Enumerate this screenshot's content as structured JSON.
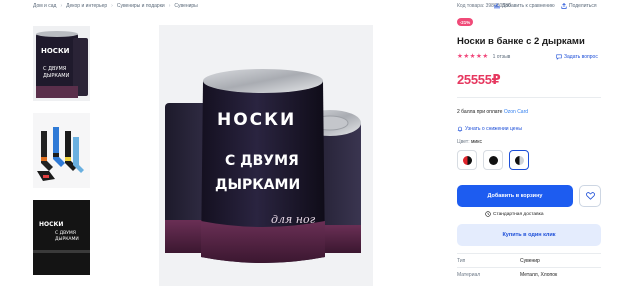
{
  "breadcrumbs": [
    "Дом и сад",
    "Декор и интерьер",
    "Сувениры и подарки",
    "Сувениры"
  ],
  "meta": {
    "product_code": "Код товара: 398680580",
    "compare_label": "Добавить к сравнению",
    "share_label": "Поделиться"
  },
  "product": {
    "discount_badge": "-21%",
    "title": "Носки в банке с 2 дырками",
    "reviews": "1 отзыв",
    "ask_label": "Задать вопрос",
    "price": "25555₽",
    "bonus_text": "2 балла при оплате",
    "bonus_brand": "Ozon Card",
    "notify_label": "Узнать о снижении цены",
    "color_label": "Цвет:",
    "color_value": "микс",
    "swatches": [
      {
        "left": "#e0242b",
        "right": "#111111"
      },
      {
        "left": "#111111",
        "right": "#111111"
      },
      {
        "left": "#111111",
        "right": "#cfd3d8"
      }
    ],
    "add_to_cart": "Добавить в корзину",
    "delivery_label": "Стандартная доставка",
    "buy_one_click": "Купить в один клик"
  },
  "specs": [
    {
      "key": "Тип",
      "value": "Сувенир"
    },
    {
      "key": "Материал",
      "value": "Металл, Хлопок"
    }
  ],
  "can": {
    "line1": "НОСКИ",
    "line2": "С ДВУМЯ",
    "line3": "ДЫРКАМИ",
    "script_text": "для ног"
  },
  "colors": {
    "accent": "#1d5cf0",
    "price": "#e6375f",
    "star": "#f0467a",
    "badge": "#f04a78"
  }
}
